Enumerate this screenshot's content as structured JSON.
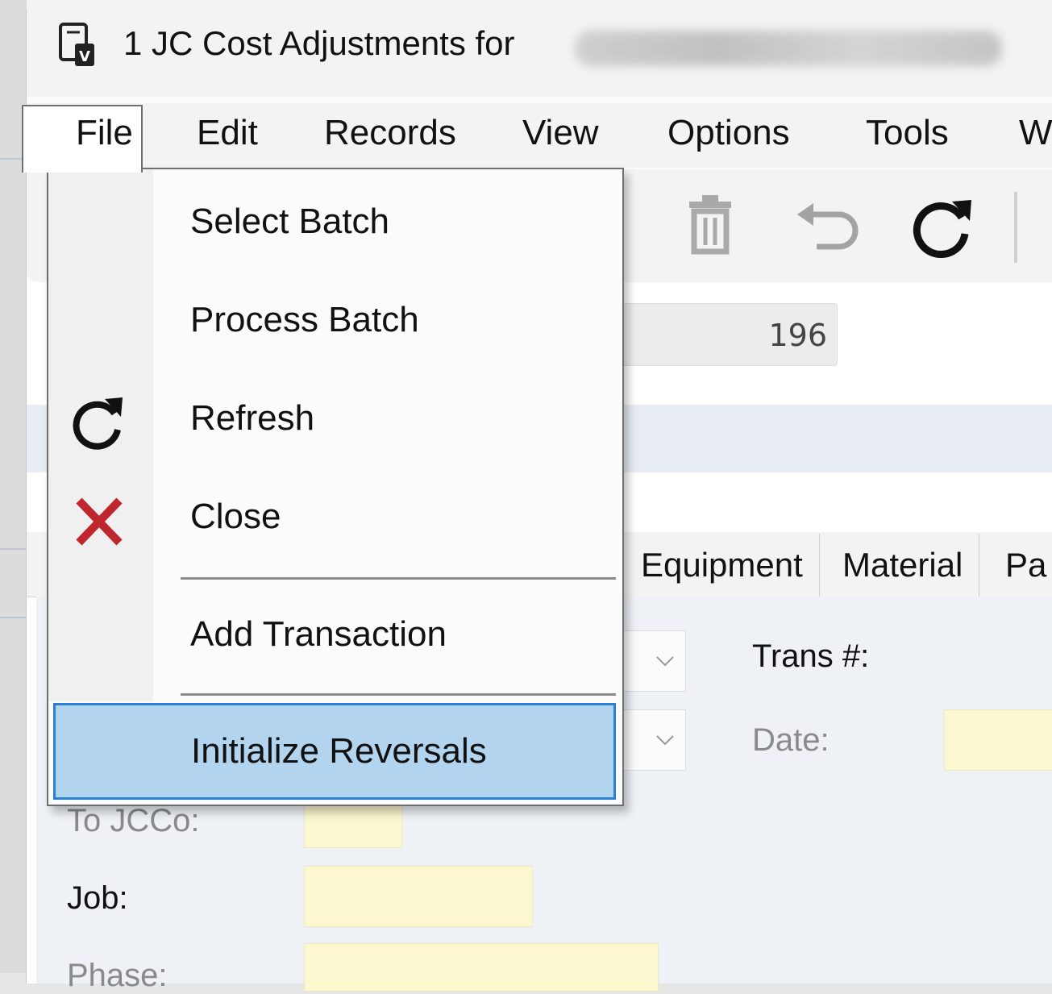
{
  "window": {
    "title": "1 JC Cost Adjustments for"
  },
  "menubar": {
    "items": [
      "File",
      "Edit",
      "Records",
      "View",
      "Options",
      "Tools",
      "W"
    ]
  },
  "file_menu": {
    "items": [
      {
        "label": "Select Batch",
        "icon": null
      },
      {
        "label": "Process Batch",
        "icon": null
      },
      {
        "label": "Refresh",
        "icon": "refresh-icon"
      },
      {
        "label": "Close",
        "icon": "close-icon"
      },
      {
        "label": "Add Transaction",
        "icon": null
      },
      {
        "label": "Initialize Reversals",
        "icon": null,
        "highlighted": true
      }
    ]
  },
  "toolbar": {
    "icons": [
      "delete-icon",
      "undo-icon",
      "refresh-icon"
    ]
  },
  "form": {
    "batch_value": "196",
    "tabs": [
      "Equipment",
      "Material",
      "Pa"
    ],
    "trans_label": "Trans #:",
    "date_label": "Date:",
    "to_jcco_label": "To JCCo:",
    "job_label": "Job:",
    "phase_label": "Phase:"
  },
  "colors": {
    "menu_highlight": "#b3d4ef",
    "menu_highlight_border": "#2b7fd0",
    "required_field": "#fbf7cf",
    "close_red": "#c0262d"
  }
}
